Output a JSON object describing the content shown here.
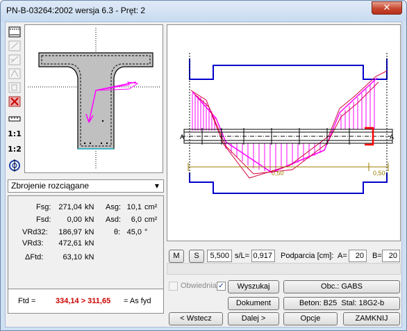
{
  "window": {
    "title": "PN-B-03264:2002 wersja 6.3 - Pręt: 2",
    "close_glyph": "✕"
  },
  "toolbar": {
    "icons": [
      "rebar-top-icon",
      "pen-a-icon",
      "pen-s-icon",
      "pen-a-box-icon",
      "pen-b-box-icon",
      "delete-icon",
      "ruler-icon",
      "scale-1-1-icon",
      "scale-1-2-icon",
      "target-icon"
    ],
    "scale_1_1": "1:1",
    "scale_1_2": "1:2"
  },
  "dropdown": {
    "value": "Zbrojenie rozciągane",
    "arrow": "▼"
  },
  "results": {
    "fsg_label": "Fsg:",
    "fsg_value": "271,04",
    "fsg_unit": "kN",
    "asg_label": "Asg:",
    "asg_value": "10,1",
    "asg_unit": "cm²",
    "fsd_label": "Fsd:",
    "fsd_value": "0,00",
    "fsd_unit": "kN",
    "asd_label": "Asd:",
    "asd_value": "6,0",
    "asd_unit": "cm²",
    "vrd32_label": "VRd32:",
    "vrd32_value": "186,97",
    "vrd32_unit": "kN",
    "theta_label": "θ:",
    "theta_value": "45,0",
    "theta_unit": "°",
    "vrd3_label": "VRd3:",
    "vrd3_value": "472,61",
    "vrd3_unit": "kN",
    "dftd_label": "ΔFtd:",
    "dftd_value": "63,10",
    "dftd_unit": "kN",
    "ftd_label": "Ftd =",
    "ftd_value": "334,14 > 311,65",
    "ftd_suffix": "= As fyd"
  },
  "diagram": {
    "labels": {
      "left_a": "A",
      "right_a": "A",
      "left_dim": "0,50",
      "right_dim": "0,50"
    },
    "colors": {
      "section": "#0000cc",
      "shear": "#ff00ff",
      "envelope": "#d4003c",
      "rebar": "#000000",
      "dim": "#9b7b00",
      "highlight": "#ff0000"
    }
  },
  "controls": {
    "m_button": "M",
    "s_button": "S",
    "s_value": "5,500",
    "sl_label": "s/L=",
    "sl_value": "0,917",
    "podparcia_label": "Podparcia [cm]:",
    "a_label": "A=",
    "a_value": "20",
    "b_label": "B=",
    "b_value": "20",
    "obwiednia_label": "Obwiednia",
    "wyszukaj_label": "Wyszukaj",
    "obc_label": "Obc.: GABS",
    "dokument_label": "Dokument",
    "beton_label": "Beton: B25",
    "stal_label": "Stal: 18G2-b",
    "wstecz_label": "< Wstecz",
    "dalej_label": "Dalej >",
    "opcje_label": "Opcje",
    "zamknij_label": "ZAMKNIJ",
    "check_glyph": "✓"
  }
}
